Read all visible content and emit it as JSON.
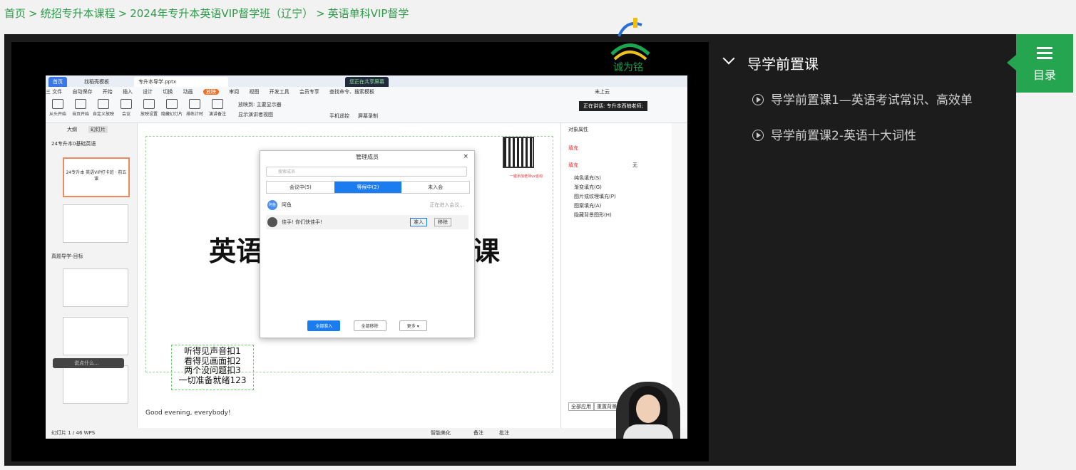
{
  "breadcrumb": {
    "home": "首页",
    "sep1": ">",
    "category": "统招专升本课程",
    "sep2": ">",
    "course": "2024年专升本英语VIP督学班（辽宁）",
    "sep3": ">",
    "current": "英语单科VIP督学"
  },
  "wps": {
    "tab_home": "首页",
    "tab_template": "找稻壳模板",
    "tab_file": "专升本导学.pptx",
    "sharing": "您正在共享屏幕",
    "menu": [
      "三 文件",
      "自动保存",
      "开始",
      "插入",
      "设计",
      "切换",
      "动画",
      "放映",
      "审阅",
      "视图",
      "开发工具",
      "会员专享",
      "查找命令、搜索模板"
    ],
    "cloud": "未上云",
    "speaking": "正在讲话: 专升本西柚老师;",
    "toolbar": [
      "从头开始",
      "当页开始",
      "自定义放映",
      "会议",
      "放映设置",
      "隐藏幻灯片",
      "排练计时",
      "演讲备注"
    ],
    "display_label": "放映到: 主要显示器",
    "show_presenter": "显示演讲者视图",
    "phone_remote": "手机遥控",
    "screen_record": "屏幕录制",
    "outline_tab": "大纲",
    "slides_tab": "幻灯片",
    "section1": "24专升本0基础英语",
    "section2": "真题导学-目标",
    "thumb1_text": "24专升本 英语VIP打卡班 · 前五课",
    "slide_big_left": "英语",
    "slide_big_right": "课",
    "qr_caption": "一键添加老师vx咨询",
    "note_lines": [
      "听得见声音扣1",
      "看得见画面扣2",
      "两个没问题扣3",
      "一切准备就绪123"
    ],
    "bottom_note": "Good evening, everybody!",
    "status_left": "幻灯片 1 / 46   WPS",
    "status_smart": "智能美化",
    "status_notes": "备注",
    "status_comment": "批注",
    "right_panel_title": "对象属性",
    "right_panel_fill": "填充",
    "fill_none": "无",
    "fill_options": [
      "纯色填充(S)",
      "渐变填充(G)",
      "图片或纹理填充(P)",
      "图案填充(A)",
      "隐藏背景图形(H)"
    ],
    "apply_all": "全部应用",
    "reset_bg": "重置背景",
    "float_toolbar": "说点什么..."
  },
  "dialog": {
    "title": "管理成员",
    "search_placeholder": "搜索成员",
    "tab_in_meeting": "会议中(5)",
    "tab_waiting": "等候中(2)",
    "tab_not_joined": "未入会",
    "member1_name": "阿鱼",
    "member1_avatar": "阿鱼",
    "member1_status": "正在进入会议...",
    "member2_name": "佳手! 你们快佳手!",
    "admit": "准入",
    "remove": "移除",
    "admit_all": "全部准入",
    "remove_all": "全部移除",
    "more": "更多 ▾"
  },
  "sidebar": {
    "section_title": "导学前置课",
    "lessons": [
      "导学前置课1—英语考试常识、高效单",
      "导学前置课2-英语十大词性"
    ],
    "menu_label": "目录"
  },
  "logo_text": "诚为铭",
  "colors": {
    "accent": "#26a550",
    "link": "#2f9a4a",
    "sidebar_bg": "#1c1c1c"
  }
}
